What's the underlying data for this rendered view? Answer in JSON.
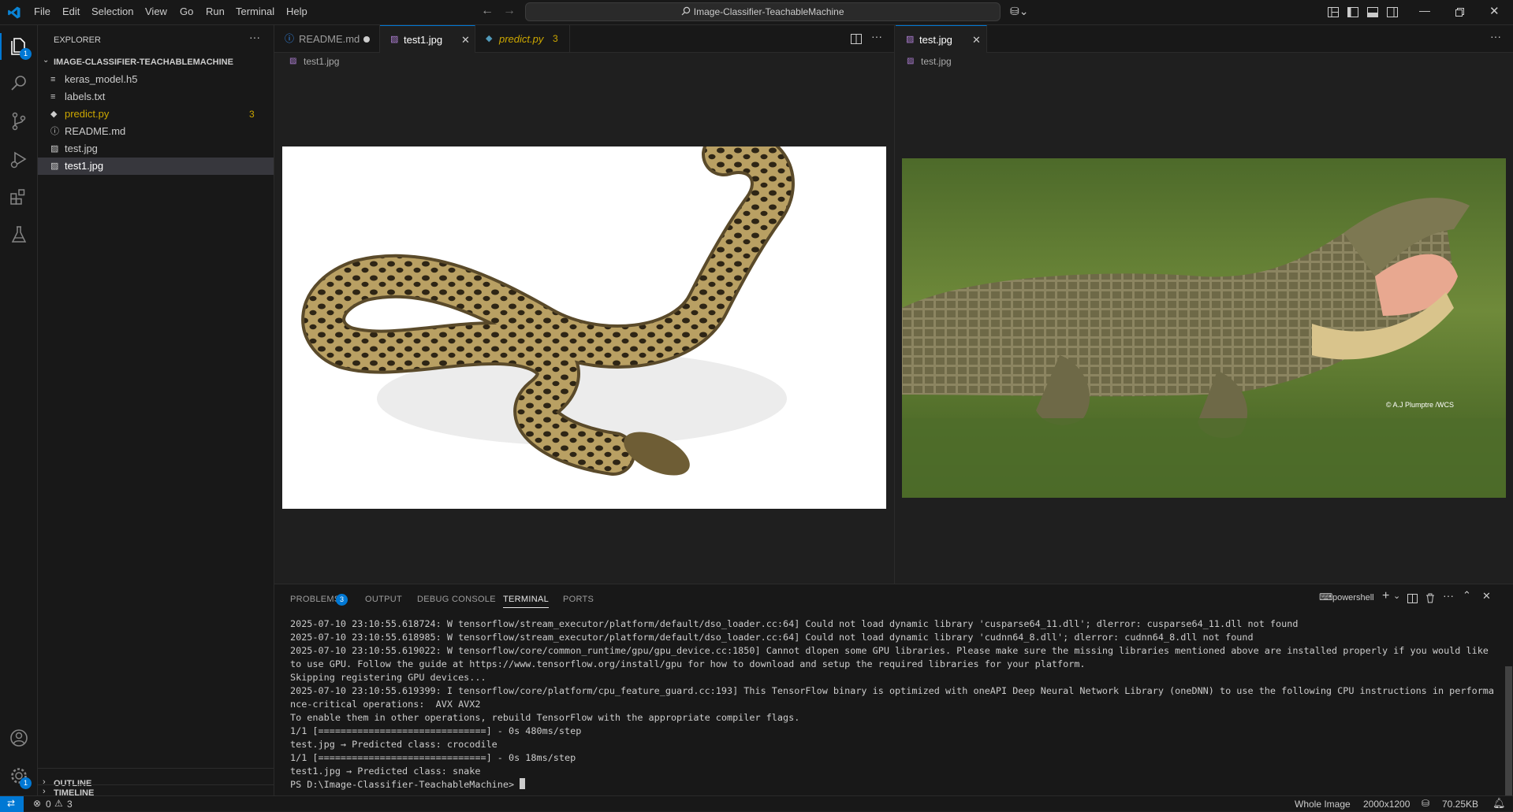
{
  "menu": [
    "File",
    "Edit",
    "Selection",
    "View",
    "Go",
    "Run",
    "Terminal",
    "Help"
  ],
  "search": {
    "text": "Image-Classifier-TeachableMachine"
  },
  "activity": {
    "explorer_badge": "1",
    "settings_badge": "1"
  },
  "sidebar": {
    "title": "EXPLORER",
    "folder": "IMAGE-CLASSIFIER-TEACHABLEMACHINE",
    "files": [
      {
        "icon": "≡",
        "name": "keras_model.h5",
        "color": "#cccccc"
      },
      {
        "icon": "≡",
        "name": "labels.txt",
        "color": "#cccccc"
      },
      {
        "icon": "◆",
        "name": "predict.py",
        "color": "#cca700",
        "badge": "3"
      },
      {
        "icon": "ⓘ",
        "name": "README.md",
        "color": "#cccccc"
      },
      {
        "icon": "▨",
        "name": "test.jpg",
        "color": "#cccccc"
      },
      {
        "icon": "▨",
        "name": "test1.jpg",
        "color": "#ffffff"
      }
    ],
    "outline": "OUTLINE",
    "timeline": "TIMELINE"
  },
  "editor_left": {
    "tabs": [
      {
        "label": "README.md",
        "icon": "ⓘ"
      },
      {
        "label": "test1.jpg",
        "icon": "▨"
      },
      {
        "label": "predict.py",
        "icon": "◆",
        "badge": "3"
      }
    ],
    "breadcrumb": "test1.jpg"
  },
  "editor_right": {
    "tabs": [
      {
        "label": "test.jpg",
        "icon": "▨"
      }
    ],
    "breadcrumb": "test.jpg",
    "watermark": "© A.J Plumptre /WCS"
  },
  "panel": {
    "tabs": [
      "PROBLEMS",
      "OUTPUT",
      "DEBUG CONSOLE",
      "TERMINAL",
      "PORTS"
    ],
    "problems_badge": "3",
    "shell": "powershell",
    "terminal_lines": [
      "2025-07-10 23:10:55.618724: W tensorflow/stream_executor/platform/default/dso_loader.cc:64] Could not load dynamic library 'cusparse64_11.dll'; dlerror: cusparse64_11.dll not found",
      "2025-07-10 23:10:55.618985: W tensorflow/stream_executor/platform/default/dso_loader.cc:64] Could not load dynamic library 'cudnn64_8.dll'; dlerror: cudnn64_8.dll not found",
      "2025-07-10 23:10:55.619022: W tensorflow/core/common_runtime/gpu/gpu_device.cc:1850] Cannot dlopen some GPU libraries. Please make sure the missing libraries mentioned above are installed properly if you would like to use GPU. Follow the guide at https://www.tensorflow.org/install/gpu for how to download and setup the required libraries for your platform.",
      "Skipping registering GPU devices...",
      "2025-07-10 23:10:55.619399: I tensorflow/core/platform/cpu_feature_guard.cc:193] This TensorFlow binary is optimized with oneAPI Deep Neural Network Library (oneDNN) to use the following CPU instructions in performance-critical operations:  AVX AVX2",
      "To enable them in other operations, rebuild TensorFlow with the appropriate compiler flags.",
      "1/1 [==============================] - 0s 480ms/step",
      "test.jpg → Predicted class: crocodile",
      "1/1 [==============================] - 0s 18ms/step",
      "test1.jpg → Predicted class: snake",
      "PS D:\\Image-Classifier-TeachableMachine> "
    ]
  },
  "status": {
    "errors": "0",
    "warnings": "3",
    "view": "Whole Image",
    "dimensions": "2000x1200",
    "size": "70.25KB"
  },
  "colors": {
    "accent": "#0078d4",
    "warning": "#cca700"
  }
}
